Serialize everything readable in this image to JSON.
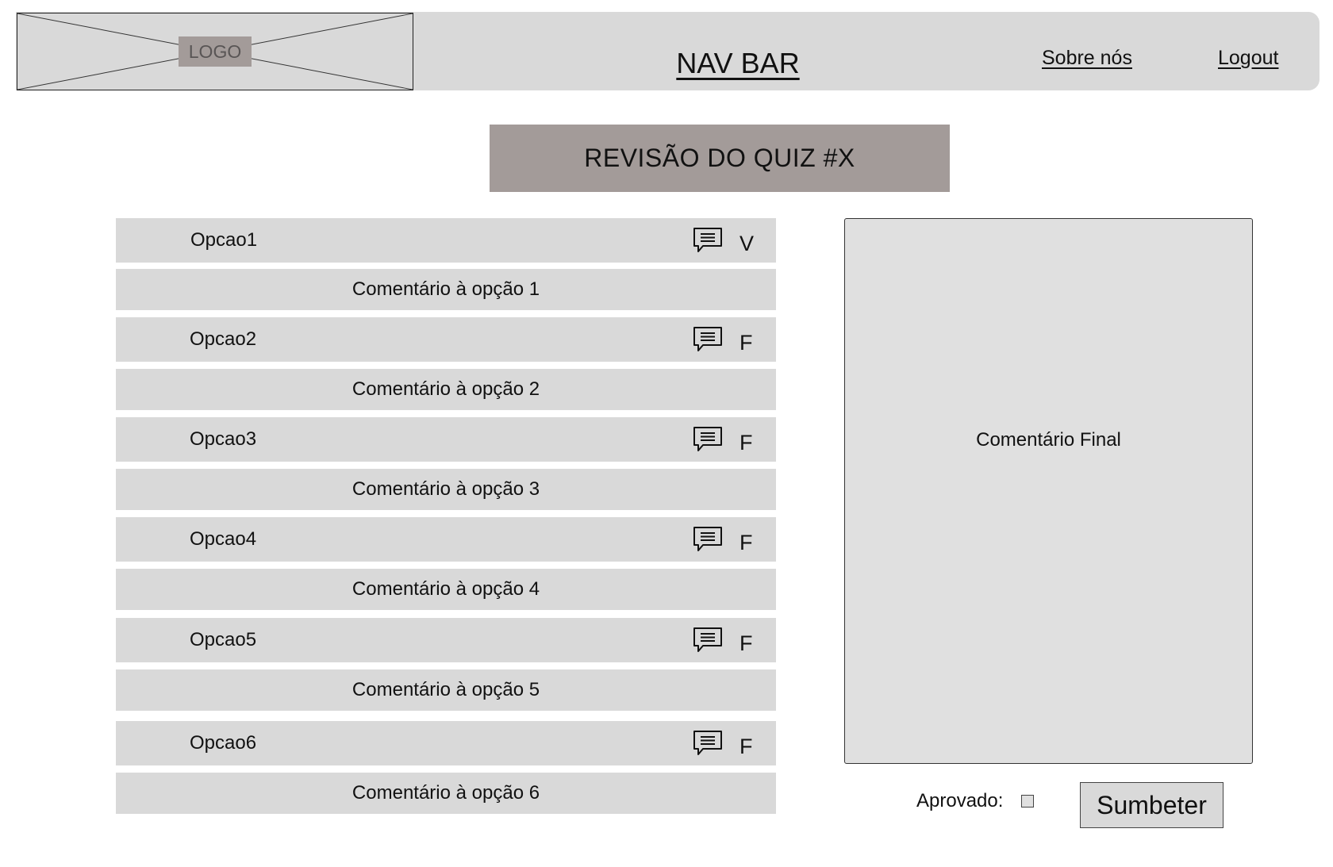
{
  "navbar": {
    "logo_text": "LOGO",
    "title": "NAV BAR",
    "links": {
      "about": "Sobre nós",
      "logout": "Logout"
    }
  },
  "page": {
    "title": "REVISÃO DO QUIZ #X"
  },
  "options": [
    {
      "label": "Opcao1",
      "value": "V",
      "comment": "Comentário à opção 1",
      "icon": "comment-icon"
    },
    {
      "label": "Opcao2",
      "value": "F",
      "comment": "Comentário à opção 2",
      "icon": "comment-icon"
    },
    {
      "label": "Opcao3",
      "value": "F",
      "comment": "Comentário à opção 3",
      "icon": "comment-icon"
    },
    {
      "label": "Opcao4",
      "value": "F",
      "comment": "Comentário à opção 4",
      "icon": "comment-icon"
    },
    {
      "label": "Opcao5",
      "value": "F",
      "comment": "Comentário à opção 5",
      "icon": "comment-icon"
    },
    {
      "label": "Opcao6",
      "value": "F",
      "comment": "Comentário à opção 6",
      "icon": "comment-icon"
    }
  ],
  "final_comment": {
    "label": "Comentário Final"
  },
  "approval": {
    "label": "Aprovado:",
    "checked": false
  },
  "submit": {
    "label": "Sumbeter"
  },
  "colors": {
    "panel_gray": "#d9d9d9",
    "title_bg": "#a39b99",
    "logo_label_bg": "#a39b99"
  }
}
